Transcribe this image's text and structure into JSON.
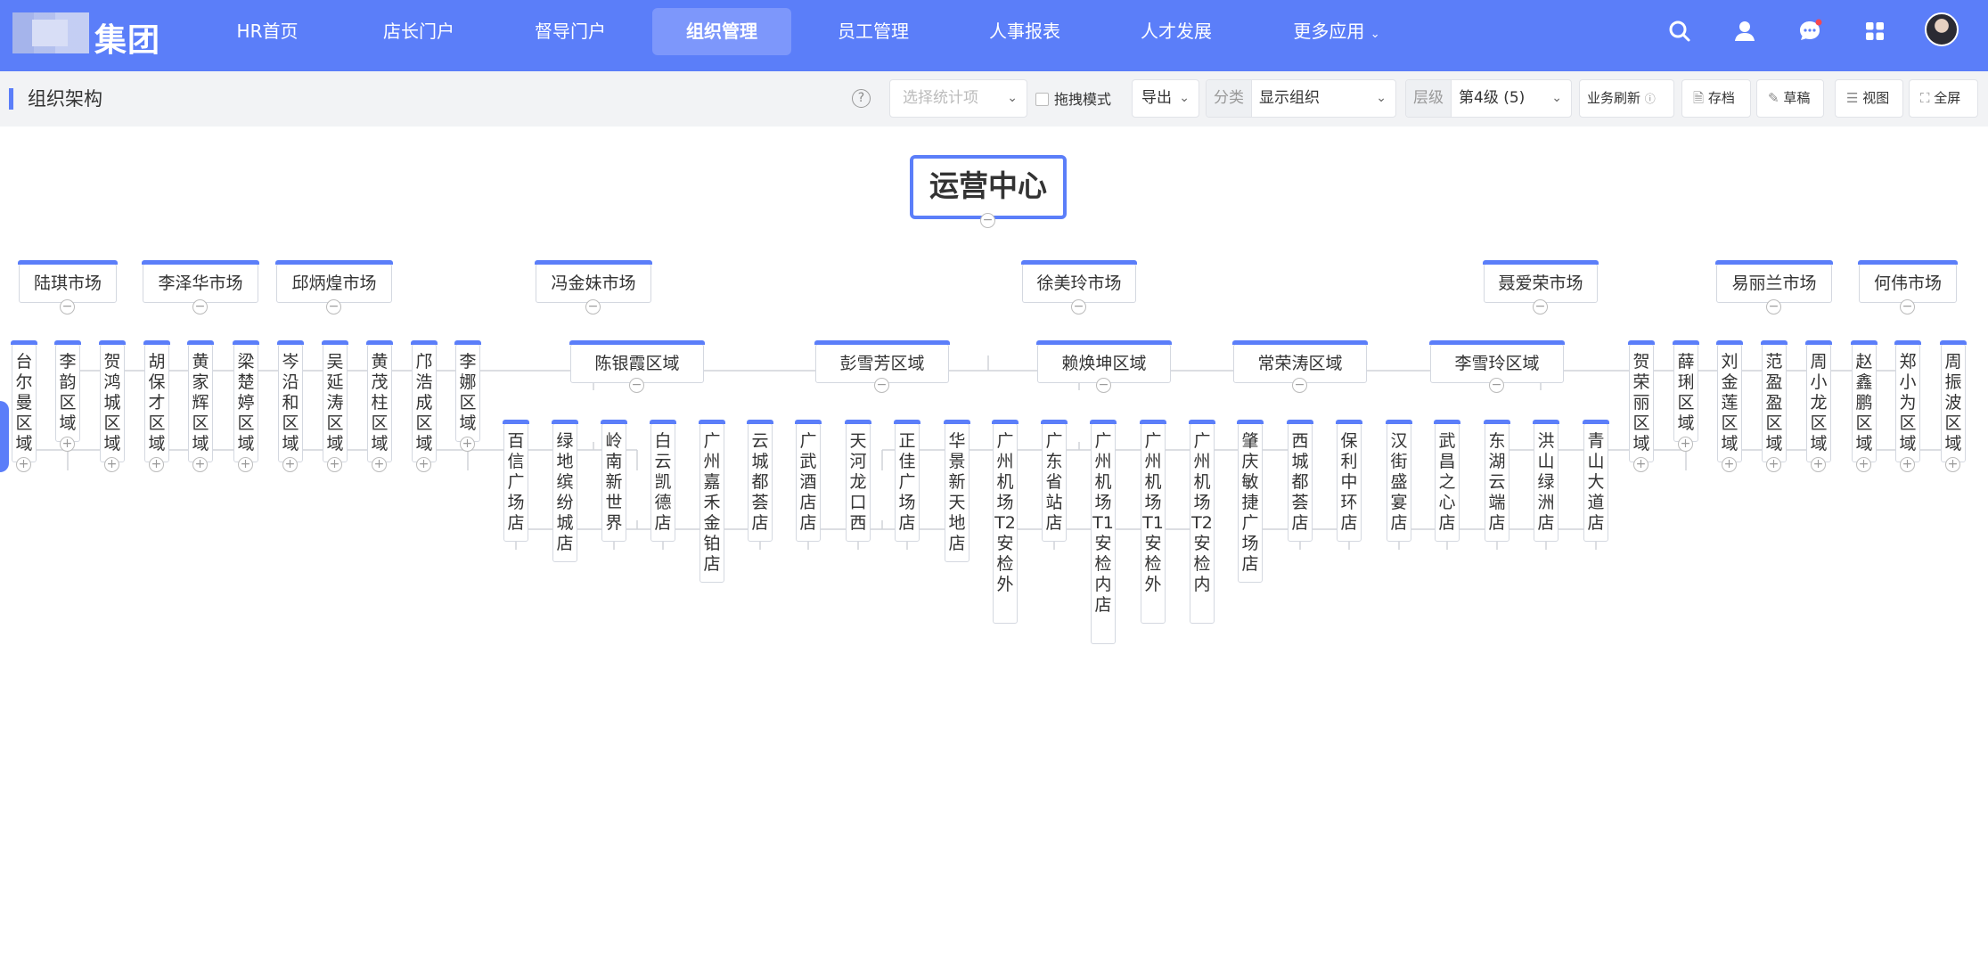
{
  "app": {
    "brand": "集团",
    "nav": [
      "HR首页",
      "店长门户",
      "督导门户",
      "组织管理",
      "员工管理",
      "人事报表",
      "人才发展",
      "更多应用"
    ],
    "active_nav": "组织管理"
  },
  "page": {
    "title": "组织架构"
  },
  "toolbar": {
    "stat_placeholder": "选择统计项",
    "drag_mode": "拖拽模式",
    "export": "导出",
    "category_label": "分类",
    "category_value": "显示组织",
    "level_label": "层级",
    "level_value": "第4级 (5)",
    "refresh": "业务刷新",
    "save": "存档",
    "draft": "草稿",
    "view": "视图",
    "fullscreen": "全屏"
  },
  "org": {
    "root": "运营中心",
    "markets": [
      {
        "name": "陆琪市场",
        "children": [
          {
            "name": "台尔曼区域"
          },
          {
            "name": "李韵区域"
          },
          {
            "name": "贺鸿城区域"
          }
        ]
      },
      {
        "name": "李泽华市场",
        "children": [
          {
            "name": "胡保才区域"
          },
          {
            "name": "黄家辉区域"
          },
          {
            "name": "梁楚婷区域"
          }
        ]
      },
      {
        "name": "邱炳煌市场",
        "children": [
          {
            "name": "岑沿和区域"
          },
          {
            "name": "吴延涛区域"
          },
          {
            "name": "黄茂柱区域"
          }
        ]
      },
      {
        "name": "冯金妹市场",
        "children": [
          {
            "name": "邝浩成区域"
          },
          {
            "name": "李娜区域"
          },
          {
            "name": "陈银霞区域",
            "stores": [
              "百信广场店",
              "绿地缤纷城店",
              "岭南新世界",
              "白云凯德店",
              "广州嘉禾金铂店",
              "云城都荟店"
            ]
          }
        ]
      },
      {
        "name": "徐美玲市场",
        "children": [
          {
            "name": "彭雪芳区域",
            "stores": [
              "广武酒店店",
              "天河龙口西",
              "正佳广场店",
              "华景新天地店"
            ]
          },
          {
            "name": "赖焕坤区域",
            "stores": [
              "广州机场T2安检外",
              "广东省站店",
              "广州机场T1安检内店",
              "广州机场T1安检外",
              "广州机场T2安检内"
            ]
          },
          {
            "name": "常荣涛区域",
            "stores": [
              "肇庆敏捷广场店",
              "西城都荟店",
              "保利中环店"
            ]
          }
        ]
      },
      {
        "name": "聂爱荣市场",
        "children": [
          {
            "name": "李雪玲区域",
            "stores": [
              "汉街盛宴店",
              "武昌之心店",
              "东湖云端店",
              "洪山绿洲店",
              "青山大道店"
            ]
          },
          {
            "name": "贺荣丽区域"
          },
          {
            "name": "薛琍区域"
          }
        ]
      },
      {
        "name": "易丽兰市场",
        "children": [
          {
            "name": "刘金莲区域"
          },
          {
            "name": "范盈盈区域"
          },
          {
            "name": "周小龙区域"
          }
        ]
      },
      {
        "name": "何伟市场",
        "children": [
          {
            "name": "赵鑫鹏区域"
          },
          {
            "name": "郑小为区域"
          },
          {
            "name": "周振波区域"
          }
        ]
      }
    ]
  },
  "colors": {
    "primary": "#5b7ef9",
    "nav_active": "#7d97fb",
    "line": "#d0d3d9"
  },
  "icons": [
    "search-icon",
    "user-icon",
    "message-icon",
    "apps-icon",
    "help-icon",
    "chevron-down-icon",
    "expand-icon",
    "collapse-icon"
  ]
}
